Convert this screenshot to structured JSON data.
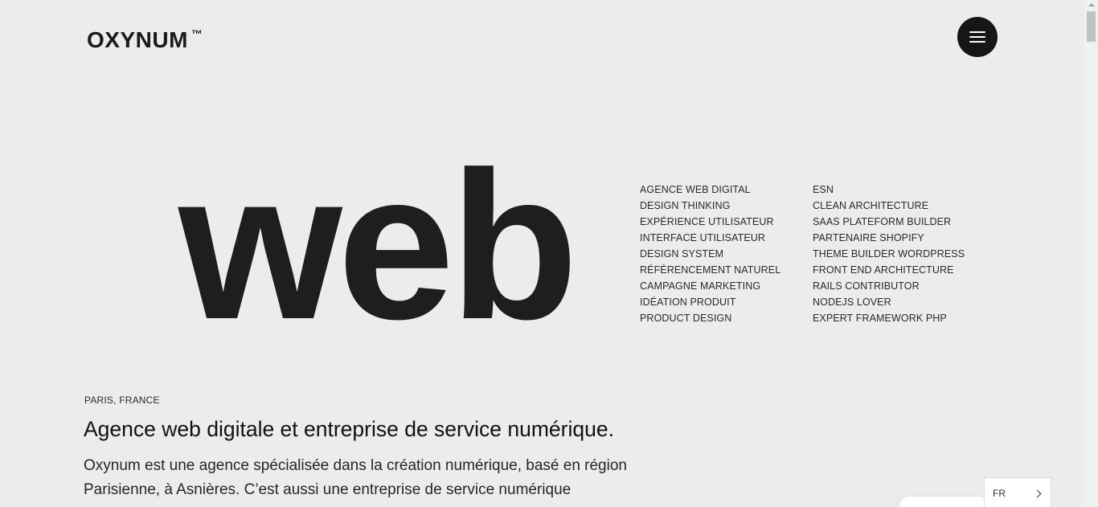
{
  "header": {
    "logo_text": "OXYNUM",
    "logo_tm": "™"
  },
  "menu": {
    "icon": "hamburger-icon"
  },
  "hero": {
    "big_word": "web"
  },
  "services": {
    "left": [
      "AGENCE WEB DIGITAL",
      "DESIGN THINKING",
      "EXPÉRIENCE UTILISATEUR",
      "INTERFACE UTILISATEUR",
      "DESIGN SYSTEM",
      "RÉFÉRENCEMENT NATUREL",
      "CAMPAGNE MARKETING",
      "IDÉATION PRODUIT",
      "PRODUCT DESIGN"
    ],
    "right": [
      "ESN",
      "CLEAN ARCHITECTURE",
      "SAAS PLATEFORM BUILDER",
      "PARTENAIRE SHOPIFY",
      "THEME BUILDER WORDPRESS",
      "FRONT END ARCHITECTURE",
      "RAILS CONTRIBUTOR",
      "NODEJS LOVER",
      "EXPERT FRAMEWORK PHP"
    ]
  },
  "intro": {
    "location": "PARIS, FRANCE",
    "headline": "Agence web digitale et entreprise de service numérique.",
    "body": "Oxynum est une agence spécialisée dans la création numérique, basé en région Parisienne, à Asnières. C’est aussi une entreprise de service numérique"
  },
  "language": {
    "current": "FR",
    "icon": "chevron-right-icon"
  },
  "colors": {
    "background": "#ececec",
    "text": "#1d1c1d",
    "menu_button": "#161616"
  }
}
